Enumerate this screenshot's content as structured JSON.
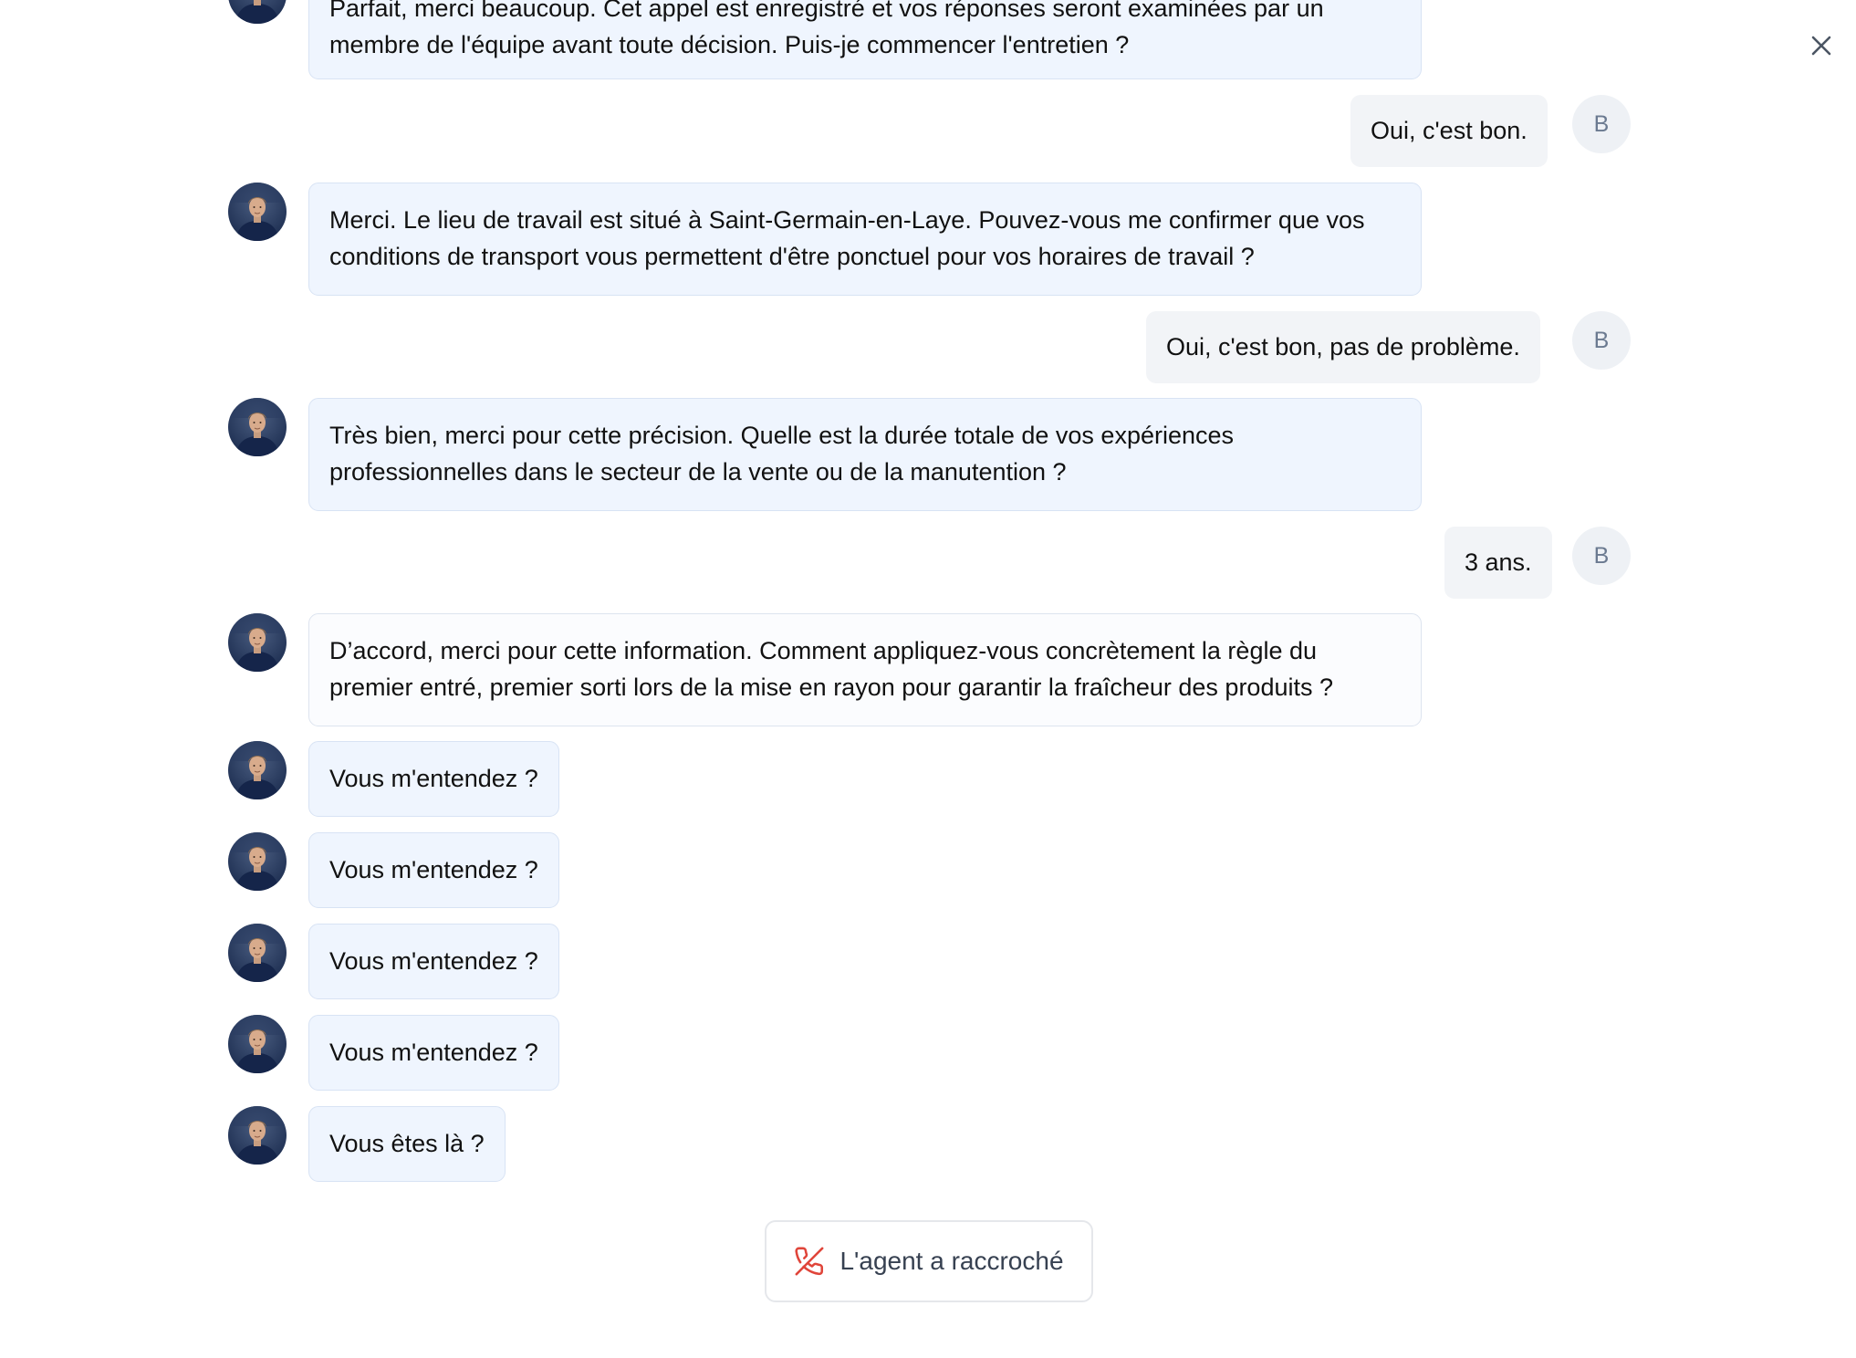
{
  "close_label": "close",
  "agent": {
    "avatar": "agent-portrait-avatar"
  },
  "user": {
    "initial": "B"
  },
  "messages": [
    {
      "role": "agent",
      "text": "Parfait, merci beaucoup. Cet appel est enregistré et vos réponses seront examinées par un membre de l'équipe avant toute décision. Puis-je commencer l'entretien ?"
    },
    {
      "role": "user",
      "text": "Oui, c'est bon."
    },
    {
      "role": "agent",
      "text": "Merci. Le lieu de travail est situé à Saint-Germain-en-Laye. Pouvez-vous me confirmer que vos conditions de transport vous permettent d'être ponctuel pour vos horaires de travail ?"
    },
    {
      "role": "user",
      "text": "Oui, c'est bon, pas de problème."
    },
    {
      "role": "agent",
      "text": "Très bien, merci pour cette précision. Quelle est la durée totale de vos expériences professionnelles dans le secteur de la vente ou de la manutention ?"
    },
    {
      "role": "user",
      "text": "3 ans."
    },
    {
      "role": "agent",
      "text": "D’accord, merci pour cette information. Comment appliquez-vous concrètement la règle du premier entré, premier sorti lors de la mise en rayon pour garantir la fraîcheur des produits ?"
    },
    {
      "role": "agent",
      "text": "Vous m'entendez ?"
    },
    {
      "role": "agent",
      "text": "Vous m'entendez ?"
    },
    {
      "role": "agent",
      "text": "Vous m'entendez ?"
    },
    {
      "role": "agent",
      "text": "Vous m'entendez ?"
    },
    {
      "role": "agent",
      "text": "Vous êtes là ?"
    }
  ],
  "status": {
    "text": "L'agent a raccroché",
    "icon": "phone-hangup-icon",
    "icon_color": "#e0453a"
  },
  "colors": {
    "agent_bubble": "#eff5fe",
    "user_bubble": "#f2f4f7",
    "avatar_bg": "#1f3a6b"
  }
}
